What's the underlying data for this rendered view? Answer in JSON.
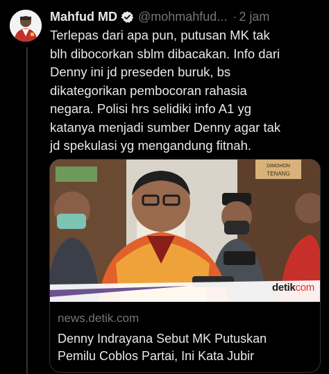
{
  "tweet": {
    "author_name": "Mahfud MD",
    "handle": "@mohmahfud...",
    "separator": "·",
    "time": "2 jam",
    "more_icon": "more-dots-icon",
    "verified_icon": "verified-badge-icon",
    "text_lines": [
      "Terlepas dari apa pun, putusan MK tak",
      "blh dibocorkan sblm dibacakan. Info dari",
      "Denny ini jd preseden buruk, bs",
      "dikategorikan pembocoran rahasia",
      "negara. Polisi hrs selidiki info A1 yg",
      "katanya menjadi sumber Denny agar tak",
      "jd spekulasi yg mengandung fitnah."
    ]
  },
  "card": {
    "domain": "news.detik.com",
    "title_lines": [
      "Denny Indrayana Sebut MK Putuskan",
      "Pemilu Coblos Partai, Ini Kata Jubir"
    ],
    "watermark_main": "detik",
    "watermark_accent": "com",
    "sign_line1": "DIMOHON",
    "sign_line2": "TENANG"
  },
  "colors": {
    "background": "#000000",
    "text": "#e7e9ea",
    "secondary": "#71767b",
    "border": "#2f3336",
    "verified": "#e7e9ea"
  }
}
